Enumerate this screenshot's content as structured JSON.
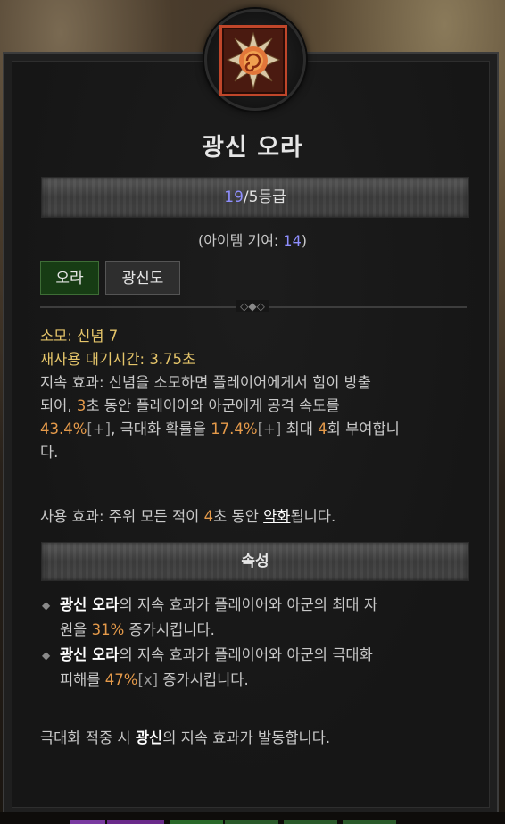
{
  "skill": {
    "name": "광신 오라",
    "rank_current": "19",
    "rank_rest": "/5등급",
    "contrib_prefix": "(아이템 기여: ",
    "contrib_value": "14",
    "contrib_suffix": ")",
    "tags": [
      "오라",
      "광신도"
    ]
  },
  "stats": {
    "cost_label": "소모: 신념 ",
    "cost_value": "7",
    "cooldown_label": "재사용 대기시간: ",
    "cooldown_value": "3.75초",
    "passive_1": "지속 효과: 신념을 소모하면 플레이어에게서 힘이 방출",
    "passive_2a": "되어, ",
    "passive_2b": "3",
    "passive_2c": "초 동안 플레이어와 아군에게 공격 속도를",
    "passive_3a": "43.4%",
    "passive_3b": "[+]",
    "passive_3c": ", 극대화 확률을 ",
    "passive_3d": "17.4%",
    "passive_3e": "[+]",
    "passive_3f": " 최대 ",
    "passive_3g": "4",
    "passive_3h": "회 부여합니",
    "passive_4": "다.",
    "active_a": "사용 효과: 주위 모든 적이 ",
    "active_b": "4",
    "active_c": "초 동안 ",
    "active_d": "약화",
    "active_e": "됩니다."
  },
  "properties": {
    "header": "속성",
    "b1_name": "광신 오라",
    "b1_a": "의 지속 효과가 플레이어와 아군의 최대 자",
    "b1_b": "원을 ",
    "b1_val": "31%",
    "b1_c": " 증가시킵니다.",
    "b2_name": "광신 오라",
    "b2_a": "의 지속 효과가 플레이어와 아군의 극대화",
    "b2_b": "피해를 ",
    "b2_val": "47%",
    "b2_x": "[x]",
    "b2_c": " 증가시킵니다.",
    "footer_a": "극대화 적중 시 ",
    "footer_b": "광신",
    "footer_c": "의 지속 효과가 발동합니다."
  },
  "colors": {
    "gold": "#e5c56a",
    "orange": "#e59a4a",
    "blue": "#8f8fff",
    "aura_tag_bg": "#173c14"
  },
  "icons": {
    "skill": "zealot-aura-icon",
    "divider": "divider-ornament-icon",
    "bullet": "diamond-bullet-icon"
  }
}
